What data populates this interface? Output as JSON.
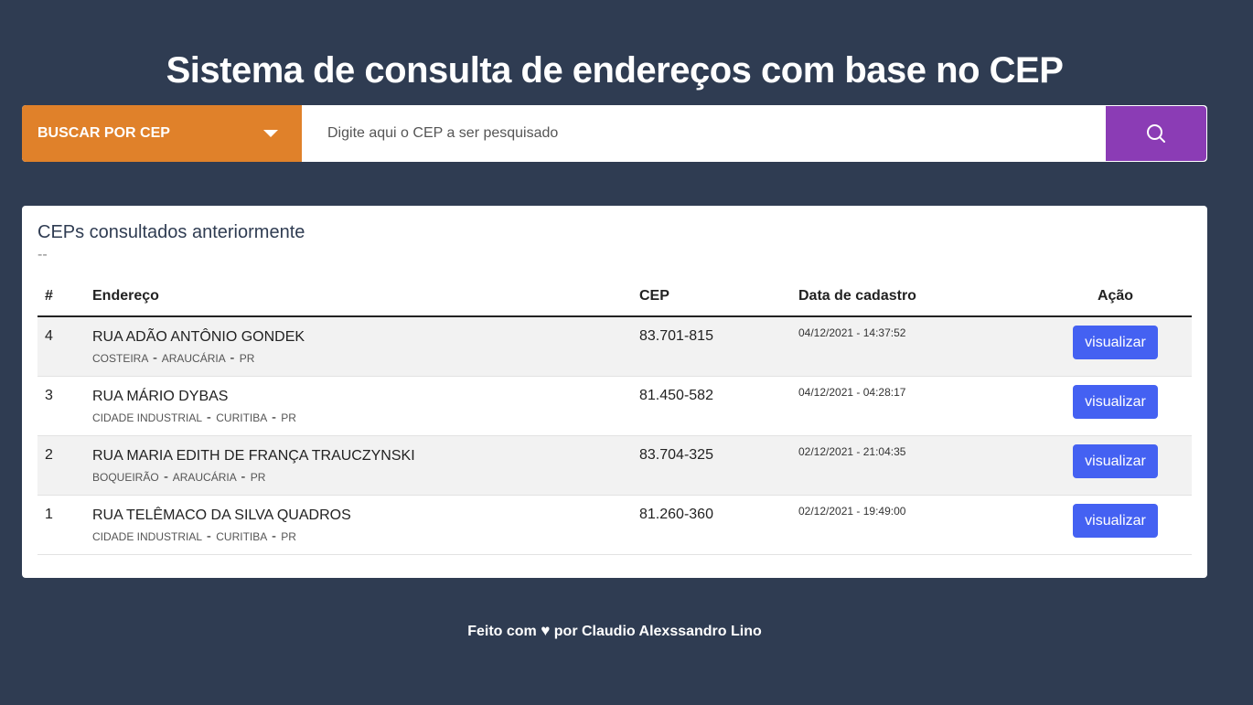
{
  "header": {
    "title": "Sistema de consulta de endereços com base no CEP"
  },
  "search": {
    "mode_label": "BUSCAR POR CEP",
    "placeholder": "Digite aqui o CEP a ser pesquisado",
    "value": ""
  },
  "history": {
    "title": "CEPs consultados anteriormente",
    "subtitle": "--",
    "columns": {
      "num": "#",
      "address": "Endereço",
      "cep": "CEP",
      "date": "Data de cadastro",
      "action": "Ação"
    },
    "rows": [
      {
        "num": "4",
        "street": "RUA ADÃO ANTÔNIO GONDEK",
        "district": "COSTEIRA",
        "city": "ARAUCÁRIA",
        "state": "PR",
        "cep": "83.701-815",
        "date": "04/12/2021 - 14:37:52",
        "action": "visualizar"
      },
      {
        "num": "3",
        "street": "RUA MÁRIO DYBAS",
        "district": "CIDADE INDUSTRIAL",
        "city": "CURITIBA",
        "state": "PR",
        "cep": "81.450-582",
        "date": "04/12/2021 - 04:28:17",
        "action": "visualizar"
      },
      {
        "num": "2",
        "street": "RUA MARIA EDITH DE FRANÇA TRAUCZYNSKI",
        "district": "BOQUEIRÃO",
        "city": "ARAUCÁRIA",
        "state": "PR",
        "cep": "83.704-325",
        "date": "02/12/2021 - 21:04:35",
        "action": "visualizar"
      },
      {
        "num": "1",
        "street": "RUA TELÊMACO DA SILVA QUADROS",
        "district": "CIDADE INDUSTRIAL",
        "city": "CURITIBA",
        "state": "PR",
        "cep": "81.260-360",
        "date": "02/12/2021 - 19:49:00",
        "action": "visualizar"
      }
    ]
  },
  "footer": {
    "prefix": "Feito com",
    "suffix": "por Claudio Alexssandro Lino"
  },
  "colors": {
    "background": "#2f3c52",
    "search_mode": "#e0812a",
    "search_button": "#8b3cb5",
    "view_button": "#4461f2"
  }
}
